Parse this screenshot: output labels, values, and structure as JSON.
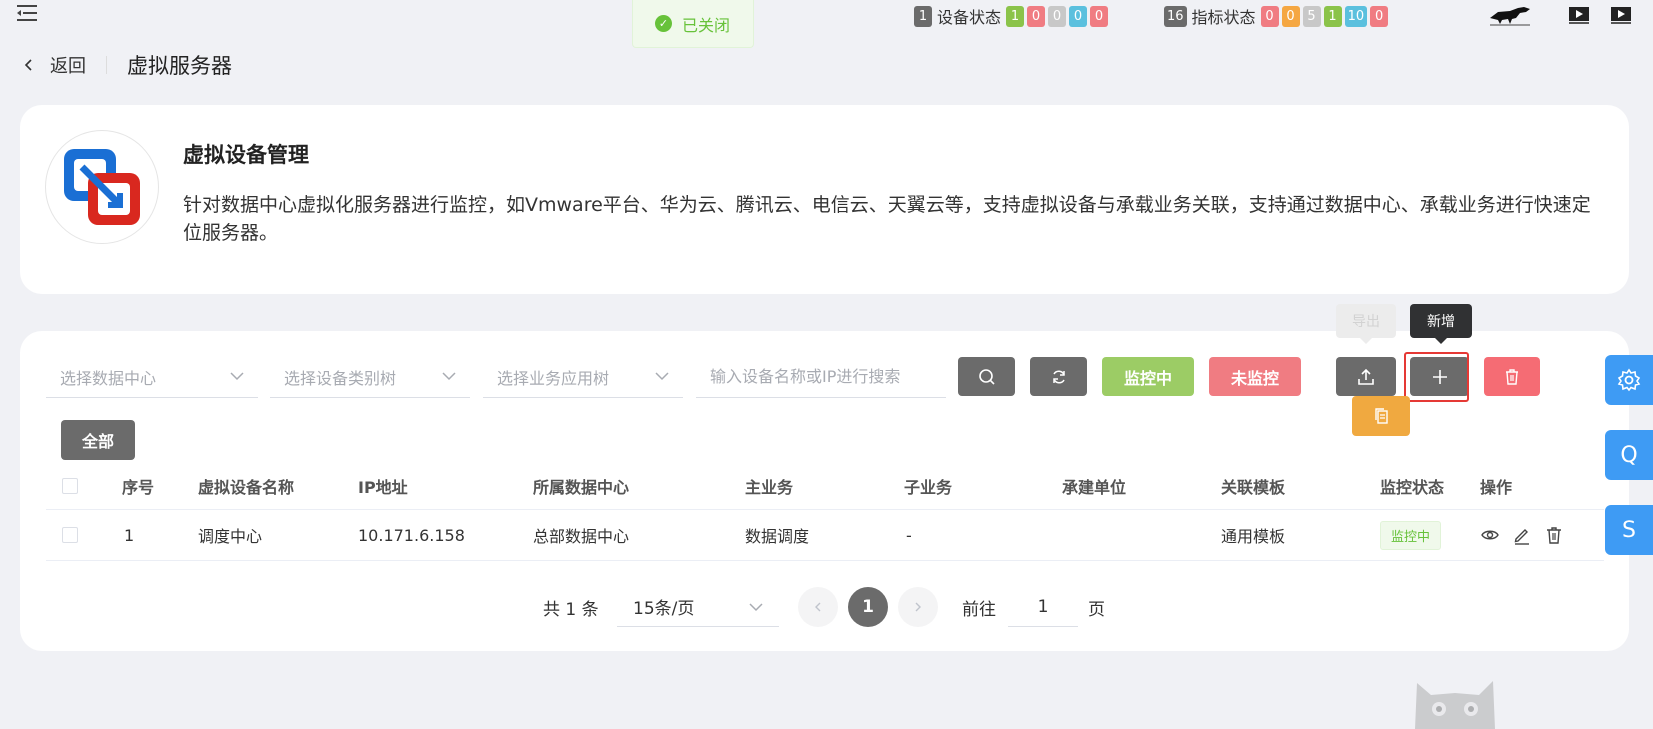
{
  "toast": {
    "text": "已关闭"
  },
  "device_status": {
    "total": "1",
    "label": "设备状态",
    "counts": [
      "1",
      "0",
      "0",
      "0",
      "0"
    ]
  },
  "metric_status": {
    "total": "16",
    "label": "指标状态",
    "counts": [
      "0",
      "0",
      "5",
      "1",
      "10",
      "0"
    ]
  },
  "breadcrumb": {
    "back": "返回",
    "title": "虚拟服务器"
  },
  "info": {
    "title": "虚拟设备管理",
    "description": "针对数据中心虚拟化服务器进行监控，如Vmware平台、华为云、腾讯云、电信云、天翼云等，支持虚拟设备与承载业务关联，支持通过数据中心、承载业务进行快速定位服务器。"
  },
  "filters": {
    "datacenter_placeholder": "选择数据中心",
    "device_type_placeholder": "选择设备类别树",
    "business_placeholder": "选择业务应用树",
    "search_placeholder": "输入设备名称或IP进行搜索"
  },
  "buttons": {
    "monitoring": "监控中",
    "not_monitoring": "未监控",
    "all": "全部",
    "export_tooltip": "导出",
    "add_tooltip": "新增"
  },
  "table": {
    "headers": [
      "序号",
      "虚拟设备名称",
      "IP地址",
      "所属数据中心",
      "主业务",
      "子业务",
      "承建单位",
      "关联模板",
      "监控状态",
      "操作"
    ],
    "rows": [
      {
        "index": "1",
        "name": "调度中心",
        "ip": "10.171.6.158",
        "datacenter": "总部数据中心",
        "main_business": "数据调度",
        "sub_business": "-",
        "builder": "",
        "template": "通用模板",
        "status": "监控中"
      }
    ]
  },
  "pagination": {
    "total_text": "共 1 条",
    "page_size": "15条/页",
    "current_page": "1",
    "goto_label": "前往",
    "goto_value": "1",
    "page_unit": "页"
  },
  "side": {
    "q": "Q",
    "s": "S"
  },
  "colors": {
    "primary": "#3e9bf4",
    "dark": "#6b6b6b",
    "green": "#9ccc65",
    "pink": "#f07c82",
    "danger": "#f56c74",
    "orange": "#f0a940"
  }
}
